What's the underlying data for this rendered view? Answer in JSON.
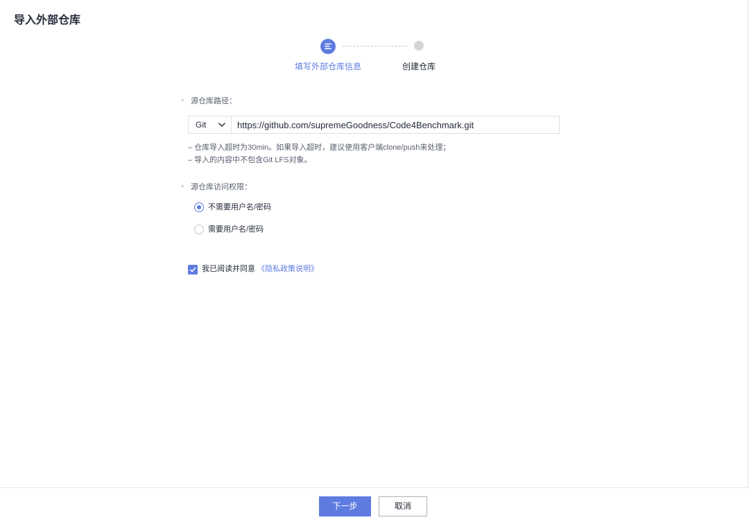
{
  "page": {
    "title": "导入外部仓库"
  },
  "stepper": {
    "steps": [
      {
        "label": "填写外部仓库信息",
        "active": true,
        "icon": "list-icon"
      },
      {
        "label": "创建仓库",
        "active": false
      }
    ]
  },
  "form": {
    "repo_path": {
      "required_mark": "*",
      "label": "源仓库路径：",
      "type_select": {
        "value": "Git",
        "icon": "chevron-down-icon"
      },
      "url_value": "https://github.com/supremeGoodness/Code4Benchmark.git"
    },
    "hints": [
      "– 仓库导入超时为30min。如果导入超时，建议使用客户端clone/push来处理；",
      "– 导入的内容中不包含Git LFS对象。"
    ],
    "access": {
      "required_mark": "*",
      "label": "源仓库访问权限：",
      "options": [
        {
          "label": "不需要用户名/密码",
          "selected": true
        },
        {
          "label": "需要用户名/密码",
          "selected": false
        }
      ]
    },
    "agreement": {
      "checked": true,
      "text": "我已阅读并同意",
      "link_text": "《隐私政策说明》"
    }
  },
  "footer": {
    "next_label": "下一步",
    "cancel_label": "取消"
  },
  "colors": {
    "accent": "#5e7ce0",
    "text": "#252b3a",
    "muted": "#575d6c",
    "pending_step": "#d5d5d5"
  }
}
